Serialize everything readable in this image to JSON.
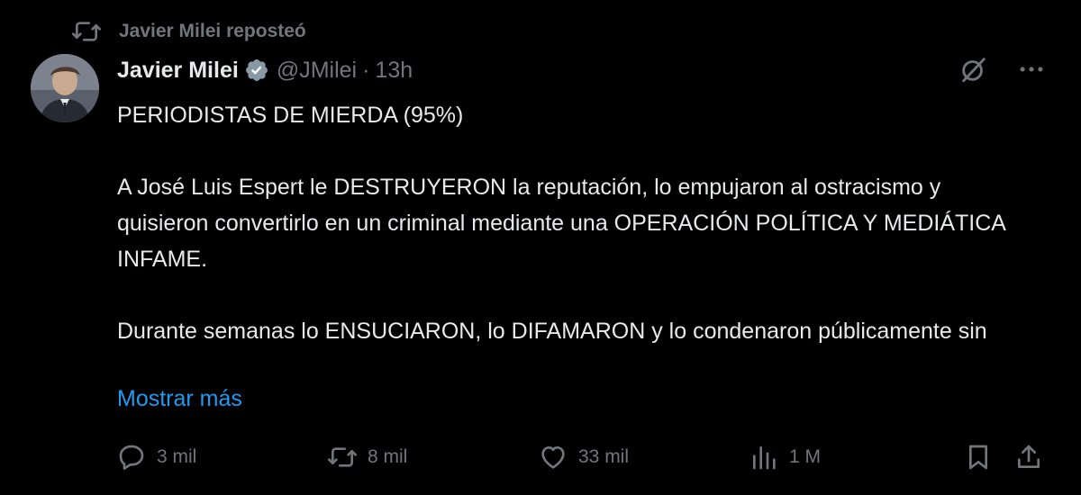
{
  "repost": {
    "icon": "retweet-icon",
    "label": "Javier Milei reposteó"
  },
  "tweet": {
    "author_name": "Javier Milei",
    "verified": true,
    "handle": "@JMilei",
    "separator": "·",
    "time": "13h",
    "paragraphs": [
      "PERIODISTAS DE MIERDA (95%)",
      "A José Luis Espert le DESTRUYERON la reputación, lo empujaron al ostracismo y quisieron convertirlo en un criminal mediante una OPERACIÓN POLÍTICA Y MEDIÁTICA INFAME.",
      "Durante semanas lo ENSUCIARON, lo DIFAMARON y lo condenaron públicamente sin"
    ],
    "show_more": "Mostrar más"
  },
  "actions": {
    "reply_count": "3 mil",
    "retweet_count": "8 mil",
    "like_count": "33 mil",
    "views_count": "1 M"
  },
  "colors": {
    "background": "#000000",
    "text": "#e7e9ea",
    "muted": "#71767b",
    "link": "#1d9bf0",
    "verified": "#8899a6"
  }
}
